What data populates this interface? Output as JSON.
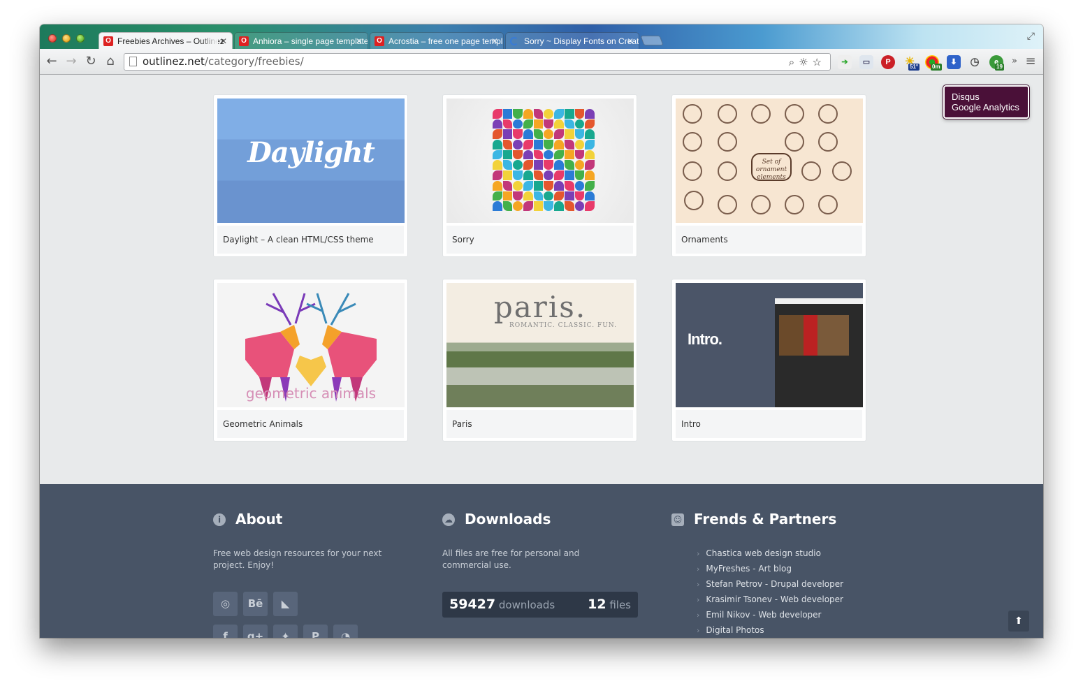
{
  "browser": {
    "tabs": [
      {
        "title": "Freebies Archives – Outlinez",
        "active": true
      },
      {
        "title": "Anhiora – single page template",
        "active": false
      },
      {
        "title": "Acrostia – free one page template",
        "active": false
      },
      {
        "title": "Sorry ~ Display Fonts on Creative Market",
        "active": false
      }
    ],
    "url": {
      "host": "outlinez.net",
      "path": "/category/freebies/"
    },
    "extensions": [
      {
        "name": "feed-icon",
        "badge": ""
      },
      {
        "name": "window-icon",
        "badge": ""
      },
      {
        "name": "pinterest-icon",
        "badge": ""
      },
      {
        "name": "weather-icon",
        "badge": "51°"
      },
      {
        "name": "traffic-icon",
        "badge": "0m"
      },
      {
        "name": "download-icon",
        "badge": ""
      },
      {
        "name": "clock-icon",
        "badge": ""
      },
      {
        "name": "evernote-icon",
        "badge": "19"
      }
    ]
  },
  "tooltip": {
    "line1": "Disqus",
    "line2": "Google Analytics"
  },
  "cards": [
    {
      "caption": "Daylight – A clean HTML/CSS theme",
      "thumb_text": "Daylight"
    },
    {
      "caption": "Sorry",
      "thumb_text": ""
    },
    {
      "caption": "Ornaments",
      "thumb_text": "Set of ornament elements"
    },
    {
      "caption": "Geometric Animals",
      "thumb_text": "geometric animals"
    },
    {
      "caption": "Paris",
      "thumb_text": "paris.",
      "thumb_sub": "ROMANTIC. CLASSIC. FUN."
    },
    {
      "caption": "Intro",
      "thumb_text": "Intro."
    }
  ],
  "footer": {
    "about": {
      "title": "About",
      "text": "Free web design resources for your next project. Enjoy!"
    },
    "downloads": {
      "title": "Downloads",
      "text": "All files are free for personal and commercial use.",
      "count": "59427",
      "count_label": "downloads",
      "files": "12",
      "files_label": "files"
    },
    "partners": {
      "title": "Frends & Partners",
      "links": [
        "Chastica web design studio",
        "MyFreshes - Art blog",
        "Stefan Petrov - Drupal developer",
        "Krasimir Tsonev - Web developer",
        "Emil Nikov - Web developer",
        "Digital Photos"
      ]
    },
    "social_top": [
      {
        "icon": "dribbble-icon",
        "glyph": "◎"
      },
      {
        "icon": "behance-icon",
        "glyph": "Bē"
      },
      {
        "icon": "deviantart-icon",
        "glyph": "◣"
      }
    ],
    "social_bottom": [
      {
        "icon": "facebook-icon",
        "glyph": "f"
      },
      {
        "icon": "googleplus-icon",
        "glyph": "g+"
      },
      {
        "icon": "twitter-icon",
        "glyph": "✦"
      },
      {
        "icon": "pinterest-icon",
        "glyph": "P"
      },
      {
        "icon": "rss-icon",
        "glyph": "◔"
      }
    ]
  }
}
